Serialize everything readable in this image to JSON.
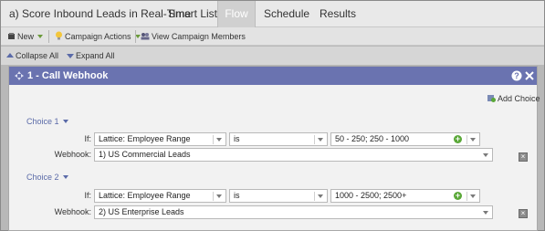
{
  "tabs": {
    "program_title": "a) Score Inbound Leads in Real-Time",
    "items": [
      "Smart List",
      "Flow",
      "Schedule",
      "Results"
    ],
    "active": "Flow"
  },
  "toolbar": {
    "new_label": "New",
    "campaign_actions_label": "Campaign Actions",
    "view_members_label": "View Campaign Members"
  },
  "subbar": {
    "collapse_label": "Collapse All",
    "expand_label": "Expand All"
  },
  "step": {
    "title": "1 - Call Webhook",
    "add_choice_label": "Add Choice",
    "choices": [
      {
        "label": "Choice 1",
        "if_label": "If:",
        "attribute": "Lattice: Employee Range",
        "operator": "is",
        "value": "50 - 250; 250 - 1000",
        "webhook_label": "Webhook:",
        "webhook": "1) US Commercial Leads"
      },
      {
        "label": "Choice 2",
        "if_label": "If:",
        "attribute": "Lattice: Employee Range",
        "operator": "is",
        "value": "1000 - 2500; 2500+",
        "webhook_label": "Webhook:",
        "webhook": "2) US Enterprise Leads"
      }
    ]
  },
  "colors": {
    "header": "#6a73b0",
    "choice_label": "#5a6aa8",
    "add_green": "#5aa838"
  }
}
